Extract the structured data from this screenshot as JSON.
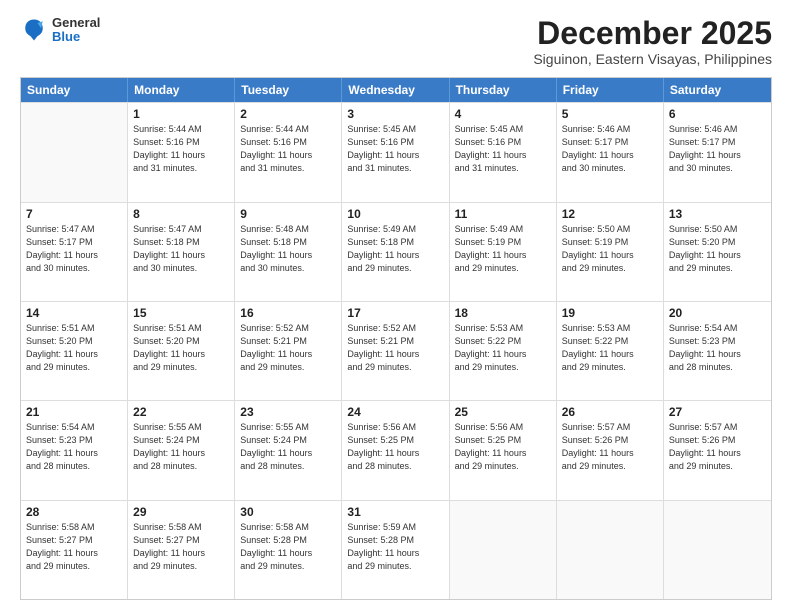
{
  "header": {
    "logo": {
      "general": "General",
      "blue": "Blue"
    },
    "title": "December 2025",
    "location": "Siguinon, Eastern Visayas, Philippines"
  },
  "calendar": {
    "days": [
      "Sunday",
      "Monday",
      "Tuesday",
      "Wednesday",
      "Thursday",
      "Friday",
      "Saturday"
    ],
    "weeks": [
      [
        {
          "day": "",
          "info": ""
        },
        {
          "day": "1",
          "info": "Sunrise: 5:44 AM\nSunset: 5:16 PM\nDaylight: 11 hours\nand 31 minutes."
        },
        {
          "day": "2",
          "info": "Sunrise: 5:44 AM\nSunset: 5:16 PM\nDaylight: 11 hours\nand 31 minutes."
        },
        {
          "day": "3",
          "info": "Sunrise: 5:45 AM\nSunset: 5:16 PM\nDaylight: 11 hours\nand 31 minutes."
        },
        {
          "day": "4",
          "info": "Sunrise: 5:45 AM\nSunset: 5:16 PM\nDaylight: 11 hours\nand 31 minutes."
        },
        {
          "day": "5",
          "info": "Sunrise: 5:46 AM\nSunset: 5:17 PM\nDaylight: 11 hours\nand 30 minutes."
        },
        {
          "day": "6",
          "info": "Sunrise: 5:46 AM\nSunset: 5:17 PM\nDaylight: 11 hours\nand 30 minutes."
        }
      ],
      [
        {
          "day": "7",
          "info": "Sunrise: 5:47 AM\nSunset: 5:17 PM\nDaylight: 11 hours\nand 30 minutes."
        },
        {
          "day": "8",
          "info": "Sunrise: 5:47 AM\nSunset: 5:18 PM\nDaylight: 11 hours\nand 30 minutes."
        },
        {
          "day": "9",
          "info": "Sunrise: 5:48 AM\nSunset: 5:18 PM\nDaylight: 11 hours\nand 30 minutes."
        },
        {
          "day": "10",
          "info": "Sunrise: 5:49 AM\nSunset: 5:18 PM\nDaylight: 11 hours\nand 29 minutes."
        },
        {
          "day": "11",
          "info": "Sunrise: 5:49 AM\nSunset: 5:19 PM\nDaylight: 11 hours\nand 29 minutes."
        },
        {
          "day": "12",
          "info": "Sunrise: 5:50 AM\nSunset: 5:19 PM\nDaylight: 11 hours\nand 29 minutes."
        },
        {
          "day": "13",
          "info": "Sunrise: 5:50 AM\nSunset: 5:20 PM\nDaylight: 11 hours\nand 29 minutes."
        }
      ],
      [
        {
          "day": "14",
          "info": "Sunrise: 5:51 AM\nSunset: 5:20 PM\nDaylight: 11 hours\nand 29 minutes."
        },
        {
          "day": "15",
          "info": "Sunrise: 5:51 AM\nSunset: 5:20 PM\nDaylight: 11 hours\nand 29 minutes."
        },
        {
          "day": "16",
          "info": "Sunrise: 5:52 AM\nSunset: 5:21 PM\nDaylight: 11 hours\nand 29 minutes."
        },
        {
          "day": "17",
          "info": "Sunrise: 5:52 AM\nSunset: 5:21 PM\nDaylight: 11 hours\nand 29 minutes."
        },
        {
          "day": "18",
          "info": "Sunrise: 5:53 AM\nSunset: 5:22 PM\nDaylight: 11 hours\nand 29 minutes."
        },
        {
          "day": "19",
          "info": "Sunrise: 5:53 AM\nSunset: 5:22 PM\nDaylight: 11 hours\nand 29 minutes."
        },
        {
          "day": "20",
          "info": "Sunrise: 5:54 AM\nSunset: 5:23 PM\nDaylight: 11 hours\nand 28 minutes."
        }
      ],
      [
        {
          "day": "21",
          "info": "Sunrise: 5:54 AM\nSunset: 5:23 PM\nDaylight: 11 hours\nand 28 minutes."
        },
        {
          "day": "22",
          "info": "Sunrise: 5:55 AM\nSunset: 5:24 PM\nDaylight: 11 hours\nand 28 minutes."
        },
        {
          "day": "23",
          "info": "Sunrise: 5:55 AM\nSunset: 5:24 PM\nDaylight: 11 hours\nand 28 minutes."
        },
        {
          "day": "24",
          "info": "Sunrise: 5:56 AM\nSunset: 5:25 PM\nDaylight: 11 hours\nand 28 minutes."
        },
        {
          "day": "25",
          "info": "Sunrise: 5:56 AM\nSunset: 5:25 PM\nDaylight: 11 hours\nand 29 minutes."
        },
        {
          "day": "26",
          "info": "Sunrise: 5:57 AM\nSunset: 5:26 PM\nDaylight: 11 hours\nand 29 minutes."
        },
        {
          "day": "27",
          "info": "Sunrise: 5:57 AM\nSunset: 5:26 PM\nDaylight: 11 hours\nand 29 minutes."
        }
      ],
      [
        {
          "day": "28",
          "info": "Sunrise: 5:58 AM\nSunset: 5:27 PM\nDaylight: 11 hours\nand 29 minutes."
        },
        {
          "day": "29",
          "info": "Sunrise: 5:58 AM\nSunset: 5:27 PM\nDaylight: 11 hours\nand 29 minutes."
        },
        {
          "day": "30",
          "info": "Sunrise: 5:58 AM\nSunset: 5:28 PM\nDaylight: 11 hours\nand 29 minutes."
        },
        {
          "day": "31",
          "info": "Sunrise: 5:59 AM\nSunset: 5:28 PM\nDaylight: 11 hours\nand 29 minutes."
        },
        {
          "day": "",
          "info": ""
        },
        {
          "day": "",
          "info": ""
        },
        {
          "day": "",
          "info": ""
        }
      ]
    ]
  }
}
